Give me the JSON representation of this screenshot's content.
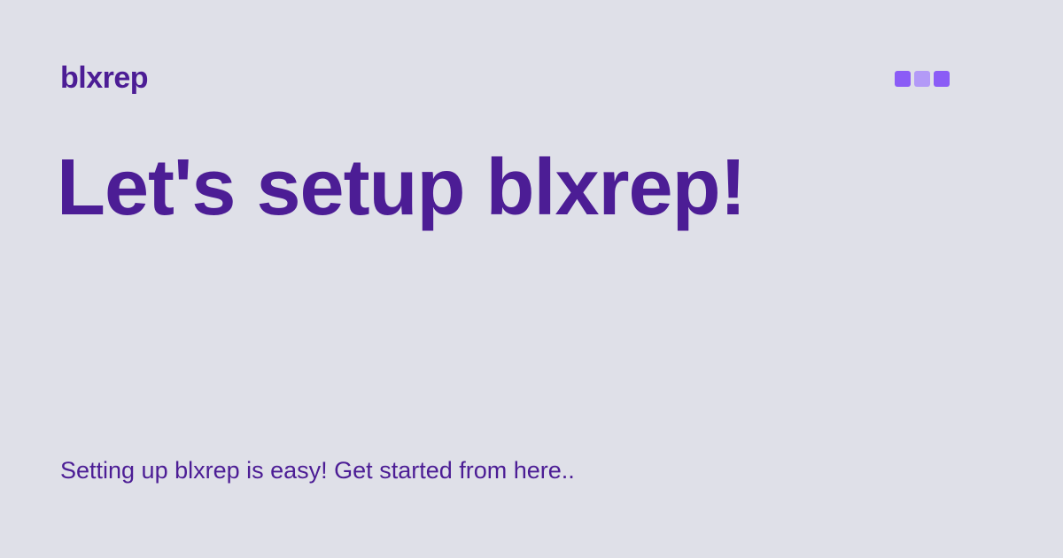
{
  "brand": {
    "name": "blxrep",
    "logo_icon": "three-squares-icon",
    "logo_colors": [
      "#8b5cf6",
      "#b39af7",
      "#8b5cf6"
    ]
  },
  "hero": {
    "headline": "Let's setup blxrep!",
    "description": "Setting up blxrep is easy! Get started from here.."
  },
  "colors": {
    "background": "#dfe0e8",
    "text": "#4c1d95"
  }
}
